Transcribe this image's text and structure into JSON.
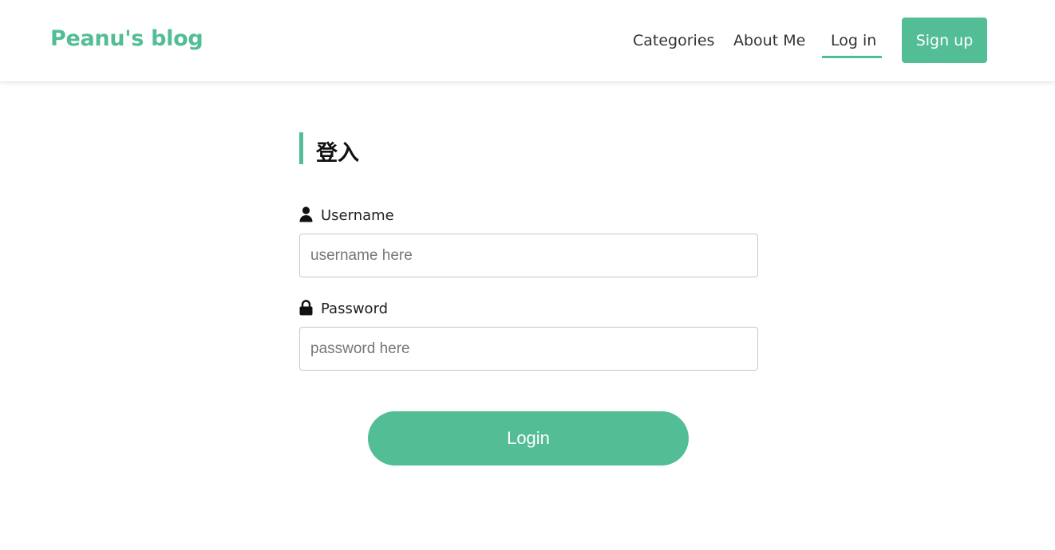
{
  "navbar": {
    "brand": "Peanu's blog",
    "links": [
      {
        "label": "Categories",
        "active": false
      },
      {
        "label": "About Me",
        "active": false
      },
      {
        "label": "Log in",
        "active": true
      }
    ],
    "signup_label": "Sign up"
  },
  "login_form": {
    "title": "登入",
    "username": {
      "icon": "user-icon",
      "label": "Username",
      "placeholder": "username here",
      "value": ""
    },
    "password": {
      "icon": "lock-icon",
      "label": "Password",
      "placeholder": "password here",
      "value": ""
    },
    "submit_label": "Login"
  },
  "colors": {
    "accent": "#53bd95",
    "text": "#222222",
    "input_border": "#c9c9c9",
    "placeholder": "#777777"
  }
}
